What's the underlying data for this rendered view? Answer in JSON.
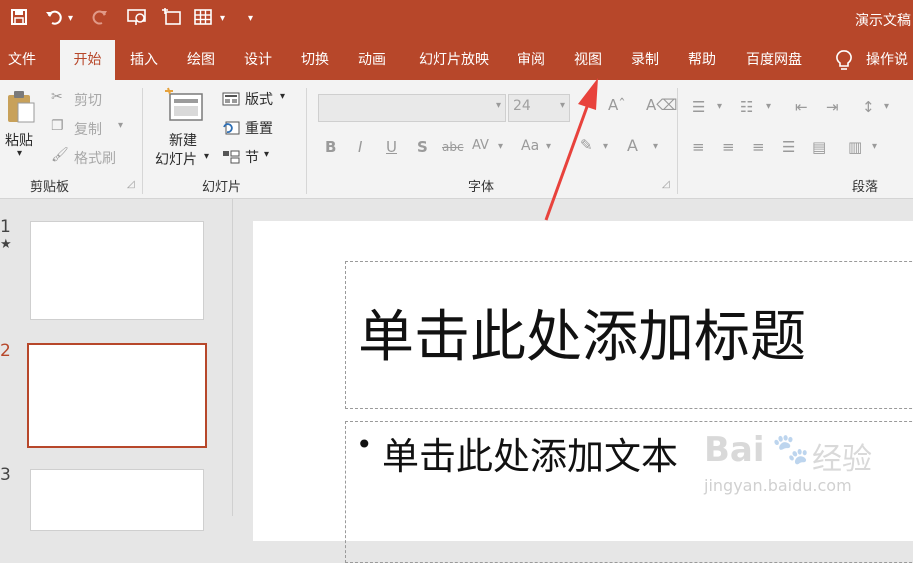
{
  "titlebar": {
    "save_icon": "save-icon",
    "undo_icon": "undo-icon",
    "redo_icon": "redo-icon",
    "presenter_icon": "slideshow-from-start-icon",
    "new_slide_icon": "new-slide-icon",
    "table_icon": "table-icon",
    "customize_icon": "customize-toolbar-icon",
    "doc_title": "演示文稿"
  },
  "tabs": [
    "文件",
    "开始",
    "插入",
    "绘图",
    "设计",
    "切换",
    "动画",
    "幻灯片放映",
    "审阅",
    "视图",
    "录制",
    "帮助",
    "百度网盘"
  ],
  "active_tab": "开始",
  "tell_me": {
    "icon": "lightbulb-icon",
    "label": "操作说"
  },
  "ribbon": {
    "clipboard": {
      "paste": "粘贴",
      "cut": "剪切",
      "copy": "复制",
      "format_painter": "格式刷",
      "group_label": "剪贴板"
    },
    "slides": {
      "new_slide_line1": "新建",
      "new_slide_line2": "幻灯片",
      "layout": "版式",
      "reset": "重置",
      "section": "节",
      "group_label": "幻灯片"
    },
    "font": {
      "font_name": "",
      "font_size": "24",
      "bold": "B",
      "italic": "I",
      "underline": "U",
      "shadow": "S",
      "strike": "abc",
      "spacing": "AV",
      "case": "Aa",
      "color": "A",
      "group_label": "字体"
    },
    "paragraph": {
      "group_label": "段落"
    }
  },
  "slides_panel": {
    "numbers": [
      "1",
      "2",
      "3"
    ],
    "star": "★",
    "selected_index": 2
  },
  "slide": {
    "title_placeholder": "单击此处添加标题",
    "body_bullet": "•",
    "body_placeholder": "单击此处添加文本"
  },
  "watermark": {
    "brand": "Bai",
    "brand_suffix": "经验",
    "url": "jingyan.baidu.com"
  },
  "colors": {
    "accent": "#b7472a",
    "annotation_arrow": "#e8423c",
    "ribbon_bg": "#f3f3f3",
    "workspace_bg": "#e6e6e6"
  }
}
